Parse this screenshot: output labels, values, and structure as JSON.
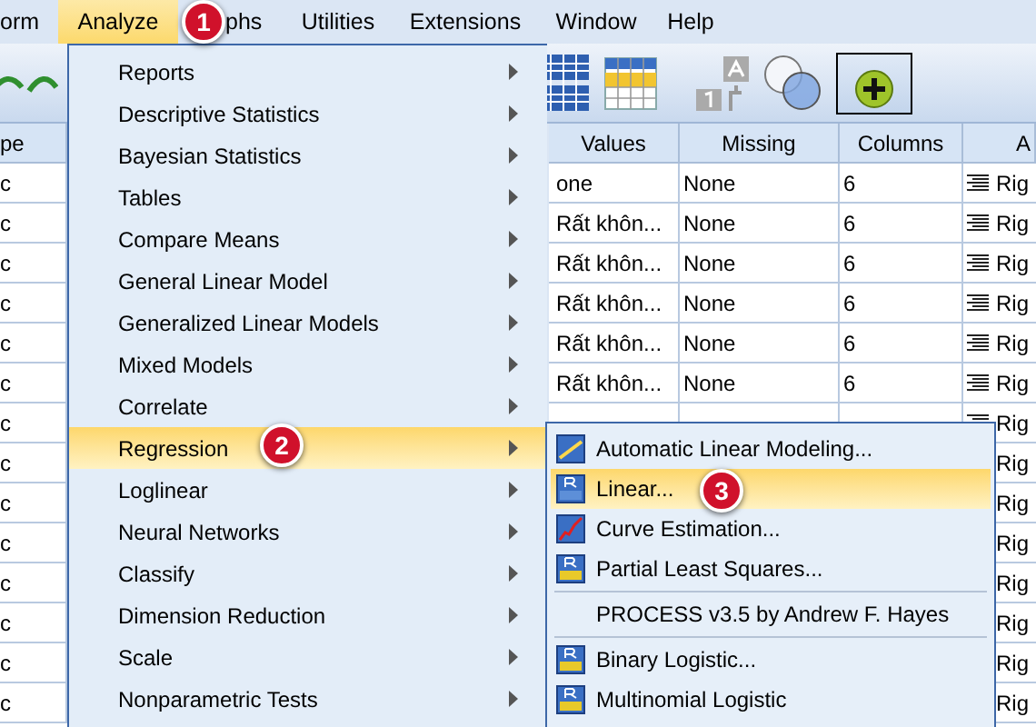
{
  "menubar": [
    {
      "label": "orm",
      "selected": false
    },
    {
      "label": "Analyze",
      "selected": true
    },
    {
      "label": "phs",
      "selected": false
    },
    {
      "label": "Utilities",
      "selected": false
    },
    {
      "label": "Extensions",
      "selected": false
    },
    {
      "label": "Window",
      "selected": false
    },
    {
      "label": "Help",
      "selected": false
    }
  ],
  "grid": {
    "columns": [
      "pe",
      "Values",
      "Missing",
      "Columns",
      "A"
    ],
    "rows": [
      {
        "type": "c",
        "values": "one",
        "missing": "None",
        "columns": "6",
        "align": "Rig"
      },
      {
        "type": "c",
        "values": "Rất khôn...",
        "missing": "None",
        "columns": "6",
        "align": "Rig"
      },
      {
        "type": "c",
        "values": "Rất khôn...",
        "missing": "None",
        "columns": "6",
        "align": "Rig"
      },
      {
        "type": "c",
        "values": "Rất khôn...",
        "missing": "None",
        "columns": "6",
        "align": "Rig"
      },
      {
        "type": "c",
        "values": "Rất khôn...",
        "missing": "None",
        "columns": "6",
        "align": "Rig"
      },
      {
        "type": "c",
        "values": "Rất khôn...",
        "missing": "None",
        "columns": "6",
        "align": "Rig"
      },
      {
        "type": "c",
        "align": "Rig"
      },
      {
        "type": "c",
        "align": "Rig"
      },
      {
        "type": "c",
        "align": "Rig"
      },
      {
        "type": "c",
        "align": "Rig"
      },
      {
        "type": "c",
        "align": "Rig"
      },
      {
        "type": "c",
        "align": "Rig"
      },
      {
        "type": "c",
        "align": "Rig"
      },
      {
        "type": "c",
        "align": "Rig"
      }
    ]
  },
  "analyze_menu": [
    {
      "label": "Reports",
      "selected": false
    },
    {
      "label": "Descriptive Statistics",
      "selected": false
    },
    {
      "label": "Bayesian Statistics",
      "selected": false
    },
    {
      "label": "Tables",
      "selected": false
    },
    {
      "label": "Compare Means",
      "selected": false
    },
    {
      "label": "General Linear Model",
      "selected": false
    },
    {
      "label": "Generalized Linear Models",
      "selected": false
    },
    {
      "label": "Mixed Models",
      "selected": false
    },
    {
      "label": "Correlate",
      "selected": false
    },
    {
      "label": "Regression",
      "selected": true
    },
    {
      "label": "Loglinear",
      "selected": false
    },
    {
      "label": "Neural Networks",
      "selected": false
    },
    {
      "label": "Classify",
      "selected": false
    },
    {
      "label": "Dimension Reduction",
      "selected": false
    },
    {
      "label": "Scale",
      "selected": false
    },
    {
      "label": "Nonparametric Tests",
      "selected": false
    }
  ],
  "regression_menu": [
    {
      "label": "Automatic Linear Modeling...",
      "selected": false,
      "kind": "auto"
    },
    {
      "label": "Linear...",
      "selected": true,
      "kind": "lin"
    },
    {
      "label": "Curve Estimation...",
      "selected": false,
      "kind": "curve"
    },
    {
      "label": "Partial Least Squares...",
      "selected": false,
      "kind": "pls"
    },
    {
      "label": "PROCESS v3.5 by Andrew F. Hayes",
      "selected": false,
      "kind": "plain"
    },
    {
      "label": "Binary Logistic...",
      "selected": false,
      "kind": "log"
    },
    {
      "label": "Multinomial Logistic",
      "selected": false,
      "kind": "mlog"
    }
  ],
  "step_badges": [
    "1",
    "2",
    "3"
  ]
}
